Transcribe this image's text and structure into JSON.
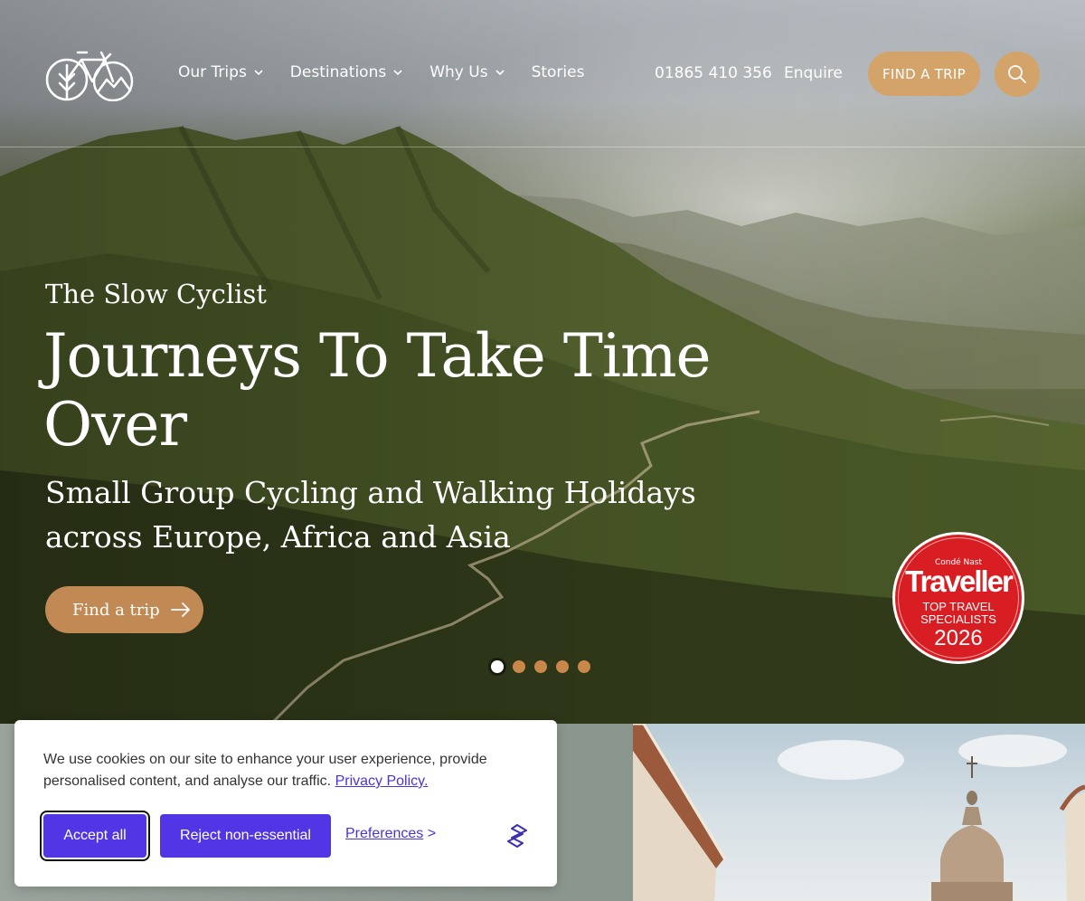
{
  "header": {
    "nav": [
      {
        "label": "Our Trips",
        "dropdown": true
      },
      {
        "label": "Destinations",
        "dropdown": true
      },
      {
        "label": "Why Us",
        "dropdown": true
      },
      {
        "label": "Stories",
        "dropdown": false
      }
    ],
    "phone": "01865 410 356",
    "enquire": "Enquire",
    "find_trip_button": "FIND A TRIP",
    "search_icon": "search-icon",
    "logo_icon": "bicycle-logo-icon"
  },
  "hero": {
    "eyebrow": "The Slow Cyclist",
    "headline": "Journeys To Take Time Over",
    "subhead": "Small Group Cycling and Walking Holidays across Europe, Africa and Asia",
    "cta": "Find a trip",
    "slides_total": 5,
    "active_slide": 1
  },
  "badge": {
    "line1": "Condé Nast",
    "line2": "Traveller",
    "line3": "TOP TRAVEL SPECIALISTS",
    "year": "2026"
  },
  "cookie": {
    "text": "We use cookies on our site to enhance your user experience, provide personalised content, and analyse our traffic.",
    "privacy_link": "Privacy Policy.",
    "accept": "Accept all",
    "reject": "Reject non-essential",
    "preferences": "Preferences",
    "preferences_suffix": ">"
  },
  "colors": {
    "accent": "#d3a36a",
    "cta": "#c18a54",
    "cookie_button": "#5235e4",
    "badge_red": "#d81e22"
  }
}
